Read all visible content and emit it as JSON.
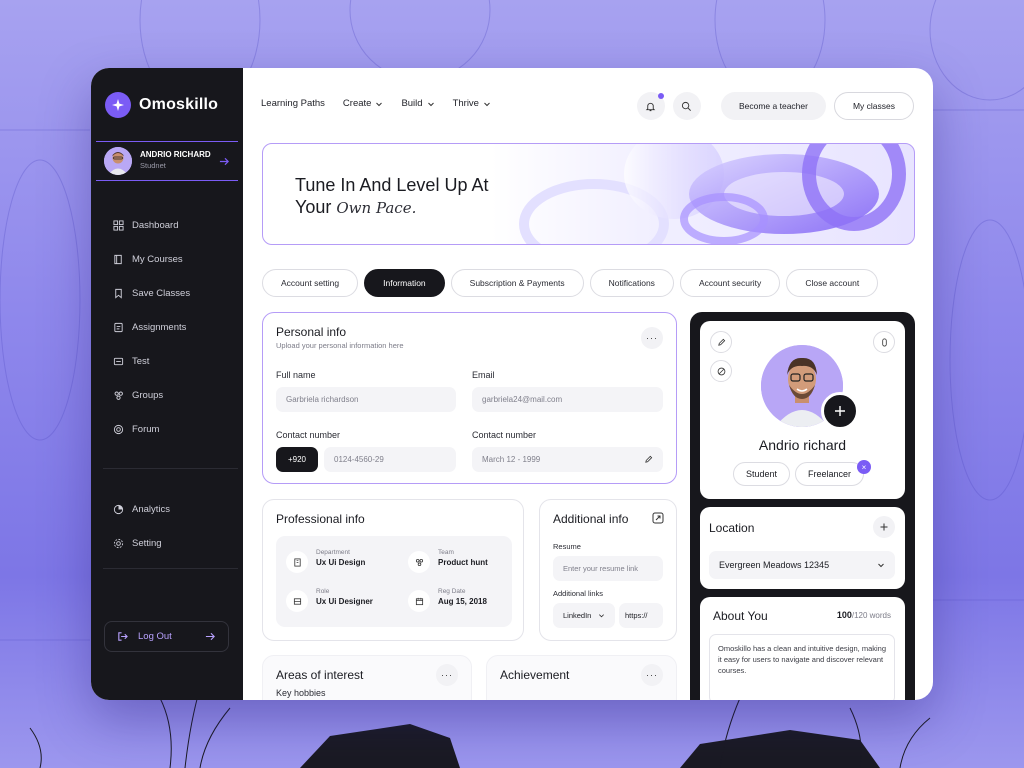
{
  "app": {
    "brand": "Omoskillo",
    "accent": "#7b5cf5",
    "sidebar_bg": "#17171c"
  },
  "profile": {
    "name": "ANDRIO RICHARD",
    "role": "Studnet"
  },
  "sidebar": {
    "items": [
      {
        "label": "Dashboard",
        "icon": "dashboard-icon"
      },
      {
        "label": "My Courses",
        "icon": "book-icon"
      },
      {
        "label": "Save Classes",
        "icon": "bookmark-icon"
      },
      {
        "label": "Assignments",
        "icon": "assignment-icon"
      },
      {
        "label": "Test",
        "icon": "test-icon"
      },
      {
        "label": "Groups",
        "icon": "groups-icon"
      },
      {
        "label": "Forum",
        "icon": "forum-icon"
      }
    ],
    "secondary": [
      {
        "label": "Analytics",
        "icon": "analytics-icon"
      },
      {
        "label": "Setting",
        "icon": "setting-icon"
      }
    ],
    "logout": "Log Out"
  },
  "topnav": {
    "items": [
      "Learning Paths",
      "Create",
      "Build",
      "Thrive"
    ],
    "become_teacher": "Become a teacher",
    "my_classes": "My classes"
  },
  "banner": {
    "line1": "Tune In And Level Up At",
    "line2a": "Your ",
    "line2b": "Own Pace."
  },
  "tabs": [
    "Account setting",
    "Information",
    "Subscription & Payments",
    "Notifications",
    "Account security",
    "Close account"
  ],
  "active_tab": "Information",
  "personal_info": {
    "title": "Personal info",
    "subtitle": "Upload your personal information here",
    "full_name_label": "Full name",
    "full_name_value": "Garbriela richardson",
    "email_label": "Email",
    "email_value": "garbriela24@mail.com",
    "contact_label": "Contact number",
    "country_code": "+920",
    "contact_value": "0124-4560-29",
    "contact2_label": "Contact number",
    "date_value": "March 12 - 1999"
  },
  "professional_info": {
    "title": "Professional info",
    "department_key": "Department",
    "department_val": "Ux Ui Design",
    "team_key": "Team",
    "team_val": "Product hunt",
    "role_key": "Role",
    "role_val": "Ux Ui Designer",
    "reg_key": "Reg Date",
    "reg_val": "Aug 15, 2018"
  },
  "additional_info": {
    "title": "Additional info",
    "resume_label": "Resume",
    "resume_placeholder": "Enter your resume link",
    "links_label": "Additional links",
    "link_type": "LinkedIn",
    "link_value": "https://"
  },
  "areas": {
    "title": "Areas of interest",
    "sub": "Key hobbies"
  },
  "achievement": {
    "title": "Achievement"
  },
  "user_card": {
    "name": "Andrio richard",
    "tag1": "Student",
    "tag2": "Freelancer",
    "remove": "×"
  },
  "location": {
    "title": "Location",
    "value": "Evergreen Meadows 12345"
  },
  "about": {
    "title": "About You",
    "count": "100",
    "max": "/120 words",
    "text": "Omoskillo has a clean and intuitive design, making it easy for users to navigate and discover relevant courses."
  }
}
